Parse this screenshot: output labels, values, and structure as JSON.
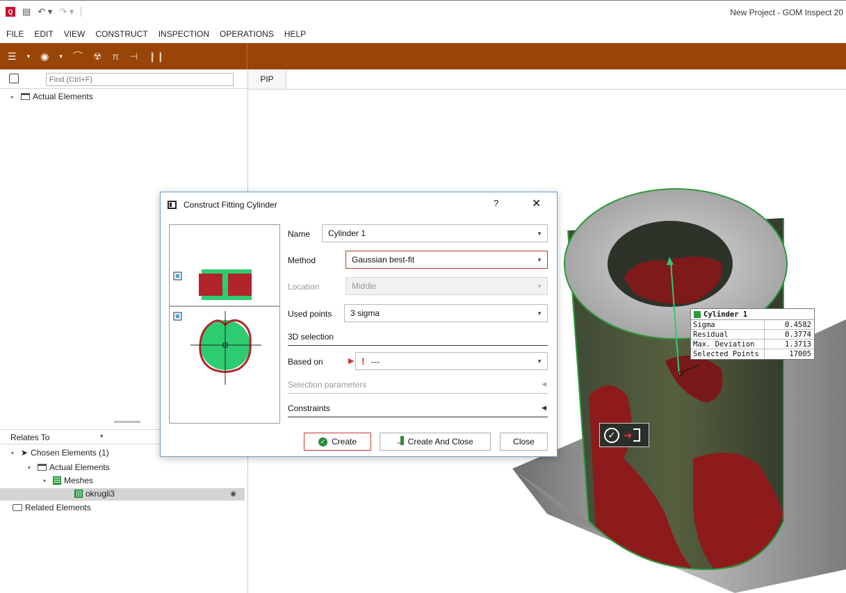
{
  "titlebar": {
    "window_title": "New Project - GOM Inspect 20",
    "app_logo": "Q"
  },
  "menubar": [
    "FILE",
    "EDIT",
    "VIEW",
    "CONSTRUCT",
    "INSPECTION",
    "OPERATIONS",
    "HELP"
  ],
  "left_panel": {
    "search_placeholder": "Find (Ctrl+F)",
    "tree_root": "Actual Elements",
    "relates_to": "Relates To",
    "chosen_elements": "Chosen Elements (1)",
    "actual_elements": "Actual Elements",
    "meshes": "Meshes",
    "mesh_item": "okrugli3",
    "related_elements": "Related Elements"
  },
  "viewport": {
    "tab": "PIP"
  },
  "dialog": {
    "title": "Construct Fitting Cylinder",
    "help": "?",
    "close": "✕",
    "name_label": "Name",
    "name_value": "Cylinder 1",
    "method_label": "Method",
    "method_value": "Gaussian best-fit",
    "location_label": "Location",
    "location_value": "Middle",
    "used_points_label": "Used points",
    "used_points_value": "3 sigma",
    "section_3d": "3D selection",
    "based_on_label": "Based on",
    "based_on_value": "---",
    "selection_parameters": "Selection parameters",
    "constraints": "Constraints",
    "btn_create": "Create",
    "btn_create_close": "Create And Close",
    "btn_close": "Close"
  },
  "info_box": {
    "title": "Cylinder 1",
    "rows": [
      {
        "key": "Sigma",
        "value": "0.4582"
      },
      {
        "key": "Residual",
        "value": "0.3774"
      },
      {
        "key": "Max. Deviation",
        "value": "1.3713"
      },
      {
        "key": "Selected Points",
        "value": "17005"
      }
    ]
  },
  "icons": {
    "toolbar": [
      "menu-icon",
      "construct-icon",
      "nominal-icon",
      "point-cloud-icon",
      "mesh-icon",
      "curve-icon",
      "spectrum-icon"
    ]
  },
  "colors": {
    "toolbar_bg": "#9a4508",
    "fit_green": "#2a9a3c",
    "deviation_red": "#8e1b1b"
  }
}
